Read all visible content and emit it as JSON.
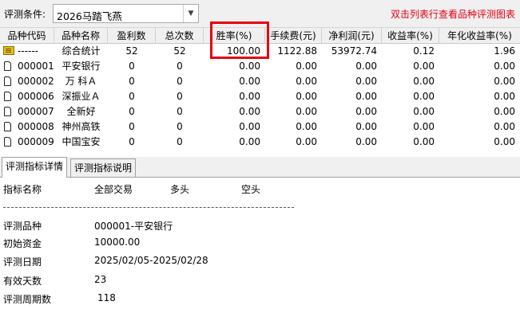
{
  "top": {
    "condition_label": "评测条件:",
    "selected_strategy": "2026马踏飞燕",
    "hint": "双击列表行查看品种评测图表"
  },
  "table": {
    "headers": [
      "品种代码",
      "品种名称",
      "盈利数",
      "总次数",
      "胜率(%)",
      "手续费(元)",
      "净利润(元)",
      "收益率(%)",
      "年化收益率(%)"
    ],
    "rows": [
      {
        "icon": "summary",
        "code": "------",
        "name": "综合统计",
        "wins": "52",
        "total": "52",
        "winrate": "100.00",
        "fee": "1122.88",
        "profit": "53972.74",
        "yield": "0.12",
        "annual": "1.96"
      },
      {
        "icon": "doc",
        "code": "000001",
        "name": "平安银行",
        "wins": "0",
        "total": "0",
        "winrate": "0.00",
        "fee": "0.00",
        "profit": "0.00",
        "yield": "0.00",
        "annual": "0.00"
      },
      {
        "icon": "doc",
        "code": "000002",
        "name": "万 科Ａ",
        "wins": "0",
        "total": "0",
        "winrate": "0.00",
        "fee": "0.00",
        "profit": "0.00",
        "yield": "0.00",
        "annual": "0.00"
      },
      {
        "icon": "doc",
        "code": "000006",
        "name": "深振业Ａ",
        "wins": "0",
        "total": "0",
        "winrate": "0.00",
        "fee": "0.00",
        "profit": "0.00",
        "yield": "0.00",
        "annual": "0.00"
      },
      {
        "icon": "doc",
        "code": "000007",
        "name": "全新好",
        "wins": "0",
        "total": "0",
        "winrate": "0.00",
        "fee": "0.00",
        "profit": "0.00",
        "yield": "0.00",
        "annual": "0.00"
      },
      {
        "icon": "doc",
        "code": "000008",
        "name": "神州高铁",
        "wins": "0",
        "total": "0",
        "winrate": "0.00",
        "fee": "0.00",
        "profit": "0.00",
        "yield": "0.00",
        "annual": "0.00"
      },
      {
        "icon": "doc",
        "code": "000009",
        "name": "中国宝安",
        "wins": "0",
        "total": "0",
        "winrate": "0.00",
        "fee": "0.00",
        "profit": "0.00",
        "yield": "0.00",
        "annual": "0.00"
      }
    ]
  },
  "tabs": [
    "评测指标详情",
    "评测指标说明"
  ],
  "detail": {
    "header_labels": [
      "指标名称",
      "全部交易",
      "多头",
      "空头"
    ],
    "items": [
      {
        "label": "评测品种",
        "value": "000001-平安银行"
      },
      {
        "label": "初始资金",
        "value": "10000.00"
      },
      {
        "label": "评测日期",
        "value": "2025/02/05-2025/02/28"
      },
      {
        "label": "有效天数",
        "value": "23"
      },
      {
        "label": "评测周期数",
        "value": "118"
      }
    ]
  },
  "colors": {
    "highlight": "#e60012",
    "hint_text": "#e60012",
    "panel_bg": "#f0f0f0"
  }
}
